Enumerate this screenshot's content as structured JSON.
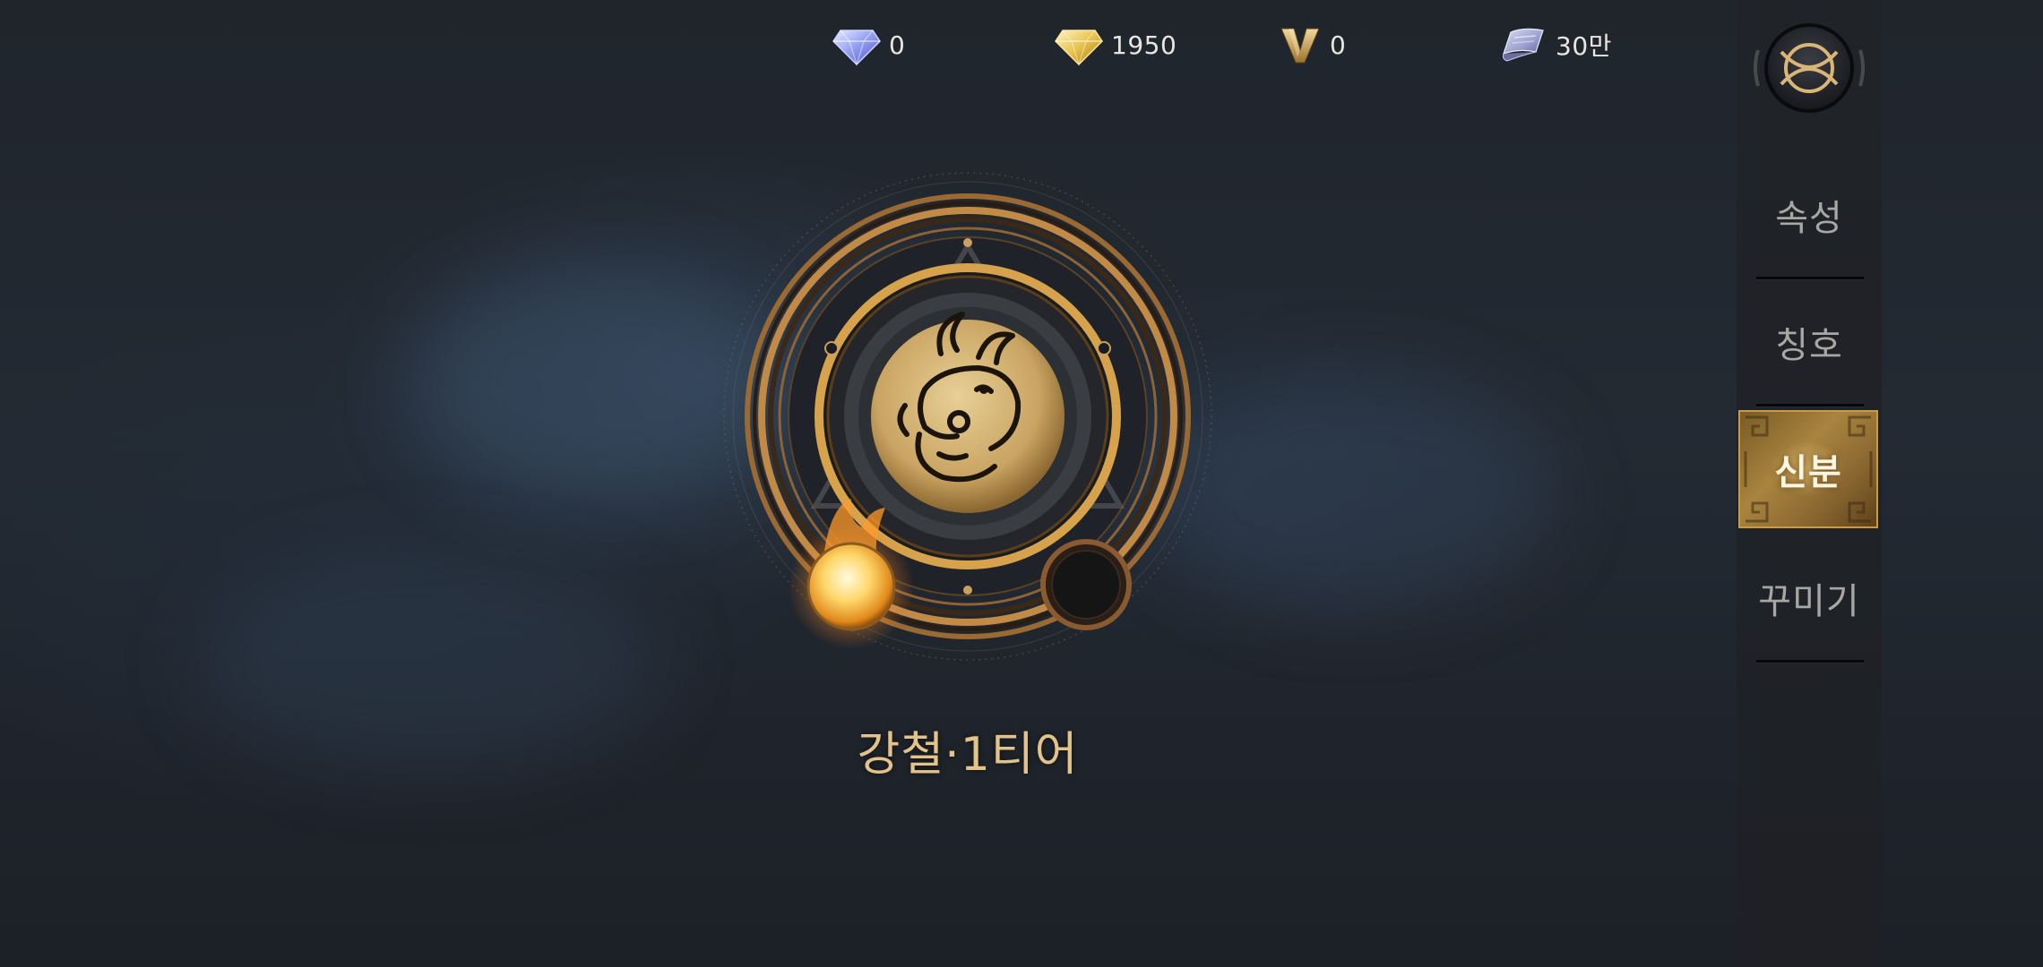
{
  "currencies": [
    {
      "icon": "blue-diamond-icon",
      "amount": "0"
    },
    {
      "icon": "gold-diamond-icon",
      "amount": "1950"
    },
    {
      "icon": "v-coin-icon",
      "amount": "0"
    },
    {
      "icon": "ticket-icon",
      "amount": "30만"
    }
  ],
  "emblem": {
    "rank_name": "강철·1티어",
    "crest_icon": "ox-crest-icon"
  },
  "sidebar": {
    "logo_icon": "game-logo-icon",
    "items": [
      {
        "label": "속성",
        "active": false
      },
      {
        "label": "칭호",
        "active": false
      },
      {
        "label": "신분",
        "active": true
      },
      {
        "label": "꾸미기",
        "active": false
      }
    ]
  },
  "colors": {
    "gold": "#d4a65a",
    "rank_text": "#e4c38a",
    "sidebar_active": "#a8843f"
  }
}
